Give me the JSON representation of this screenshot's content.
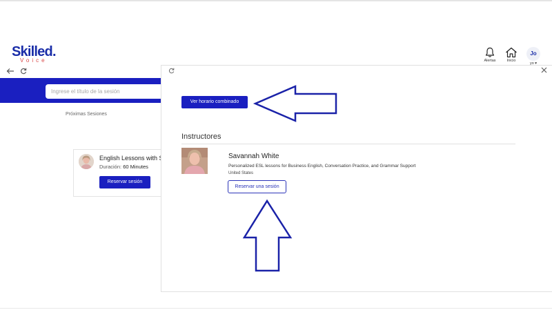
{
  "app": {
    "logo_main": "Skilled",
    "logo_dot": ".",
    "logo_sub": "Voice"
  },
  "header": {
    "alerts_label": "Alertas",
    "home_label": "Inicio",
    "user_initials": "Jo",
    "user_menu_label": "yo ▾"
  },
  "background": {
    "search_placeholder": "Ingrese el título de la sesión",
    "tab_upcoming": "Próximas Sesiones",
    "session": {
      "title": "English Lessons with S",
      "duration_label": "Duración:",
      "duration_value": "60 Minutes",
      "book_label": "Reservar sesión"
    }
  },
  "modal": {
    "combined_schedule_label": "Ver horario combinado",
    "instructors_heading": "Instructores",
    "instructor": {
      "name": "Savannah White",
      "description": "Personalized ESL lessons for Business English, Conversation Practice, and Grammar Support",
      "location": "United States",
      "reserve_label": "Reservar una sesión"
    }
  },
  "colors": {
    "brand_blue": "#1a1fc0",
    "logo_blue": "#1a2da8",
    "logo_red": "#d94848",
    "annotation_arrow": "#1a22a8"
  },
  "icons": [
    "back-arrow-icon",
    "refresh-icon",
    "bell-icon",
    "home-icon",
    "close-icon",
    "chevron-down-icon"
  ]
}
